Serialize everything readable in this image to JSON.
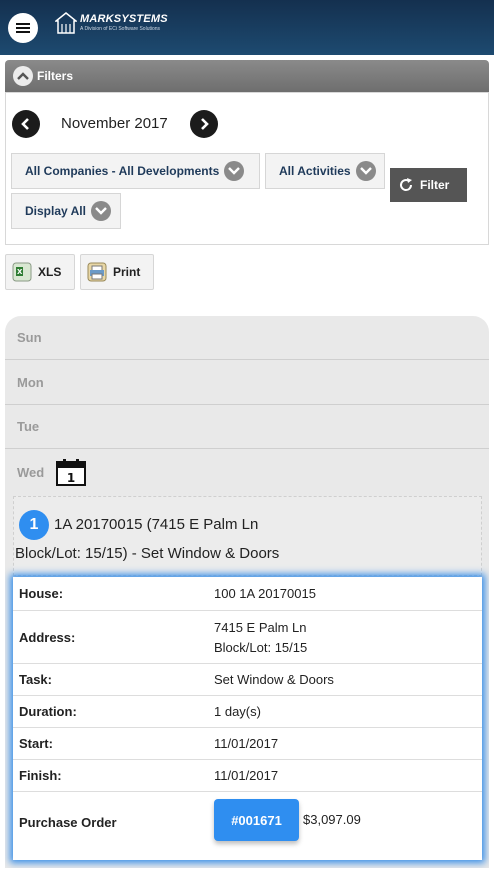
{
  "header": {
    "logo_main": "MARKSYSTEMS",
    "logo_sub": "A Division of ECi Software Solutions"
  },
  "filters": {
    "title": "Filters",
    "month": "November 2017",
    "company_select": "All Companies - All Developments",
    "activity_select": "All Activities",
    "display_select": "Display All",
    "filter_button": "Filter"
  },
  "toolbar": {
    "xls_label": "XLS",
    "print_label": "Print"
  },
  "calendar": {
    "days": [
      "Sun",
      "Mon",
      "Tue",
      "Wed"
    ],
    "calendar_icon_number": "1",
    "event": {
      "number": "1",
      "title_line1": "1A 20170015 (7415 E Palm Ln",
      "title_line2": "Block/Lot: 15/15) - Set Window & Doors",
      "house_label": "House:",
      "house_value": "100 1A 20170015",
      "address_label": "Address:",
      "address_line1": "7415 E Palm Ln",
      "address_line2": "Block/Lot: 15/15",
      "task_label": "Task:",
      "task_value": "Set Window & Doors",
      "duration_label": "Duration:",
      "duration_value": "1 day(s)",
      "start_label": "Start:",
      "start_value": "11/01/2017",
      "finish_label": "Finish:",
      "finish_value": "11/01/2017",
      "po_label": "Purchase Order",
      "po_number": "#001671",
      "po_amount": "$3,097.09"
    }
  },
  "colors": {
    "header_bg": "#1d4a70",
    "accent_blue": "#2f8ef0",
    "filter_button_bg": "#555555"
  }
}
